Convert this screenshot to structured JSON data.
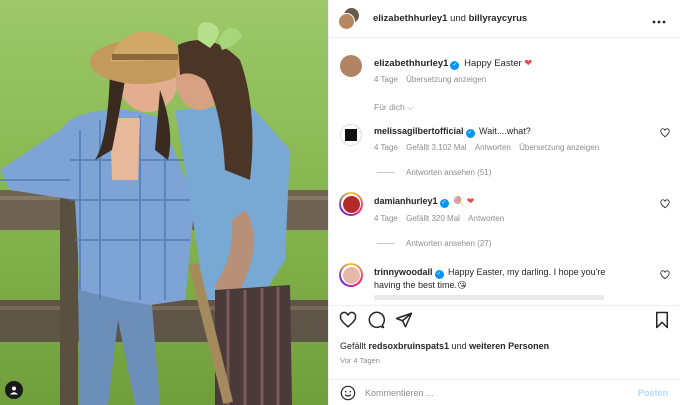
{
  "header": {
    "account_a": "elizabethhurley1",
    "conjunction": "und",
    "account_b": "billyraycyrus"
  },
  "caption": {
    "user": "elizabethhurley1",
    "text": "Happy Easter",
    "emoji": "❤",
    "time": "4 Tage",
    "translate": "Übersetzung anzeigen"
  },
  "filter": {
    "label": "Für dich"
  },
  "comments": [
    {
      "user": "melissagilbertofficial",
      "text": "Wait....what?",
      "time": "4 Tage",
      "likes": "Gefällt 3.102 Mal",
      "reply": "Antworten",
      "translate": "Übersetzung anzeigen",
      "view_replies": "Antworten ansehen (51)"
    },
    {
      "user": "damianhurley1",
      "text": "🍭 ❤",
      "time": "4 Tage",
      "likes": "Gefällt 320 Mal",
      "reply": "Antworten",
      "view_replies": "Antworten ansehen (27)"
    },
    {
      "user": "trinnywoodall",
      "text": "Happy Easter, my darling. I hope you're",
      "text2": "having the best time.",
      "emoji": "😘"
    }
  ],
  "footer": {
    "liked_prefix": "Gefällt",
    "liked_user": "redsoxbruinspats1",
    "liked_and": "und",
    "liked_others": "weiteren Personen",
    "time": "Vor 4 Tagen",
    "comment_placeholder": "Kommentieren ...",
    "post_label": "Posten"
  },
  "icons": {
    "more": "more-horizontal-icon",
    "heart": "heart-icon",
    "comment": "comment-icon",
    "share": "share-icon",
    "save": "bookmark-icon",
    "emoji": "emoji-icon",
    "user_tag": "user-tag-icon"
  },
  "colors": {
    "verified": "#0095f6",
    "heart": "#ed4956",
    "post_button_disabled": "#b3dbff",
    "muted_text": "#8e8e8e"
  }
}
